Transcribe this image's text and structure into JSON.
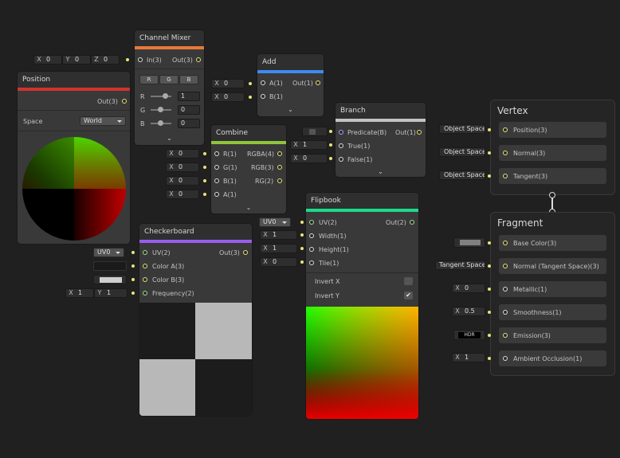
{
  "channel_mixer": {
    "title": "Channel Mixer",
    "in": "In(3)",
    "out": "Out(3)",
    "tabs": [
      "R",
      "G",
      "B"
    ],
    "rows": [
      {
        "label": "R",
        "value": "1"
      },
      {
        "label": "G",
        "value": "0"
      },
      {
        "label": "B",
        "value": "0"
      }
    ],
    "inputs": [
      {
        "k": "X",
        "v": "0"
      },
      {
        "k": "Y",
        "v": "0"
      },
      {
        "k": "Z",
        "v": "0"
      }
    ]
  },
  "position": {
    "title": "Position",
    "out": "Out(3)",
    "space_label": "Space",
    "space_value": "World"
  },
  "add": {
    "title": "Add",
    "a": "A(1)",
    "b": "B(1)",
    "out": "Out(1)",
    "inputs": [
      {
        "k": "X",
        "v": "0"
      },
      {
        "k": "X",
        "v": "0"
      }
    ]
  },
  "combine": {
    "title": "Combine",
    "ports_in": [
      "R(1)",
      "G(1)",
      "B(1)",
      "A(1)"
    ],
    "ports_out": [
      "RGBA(4)",
      "RGB(3)",
      "RG(2)"
    ],
    "inputs": [
      {
        "k": "X",
        "v": "0"
      },
      {
        "k": "X",
        "v": "0"
      },
      {
        "k": "X",
        "v": "0"
      },
      {
        "k": "X",
        "v": "0"
      }
    ]
  },
  "branch": {
    "title": "Branch",
    "ports_in": [
      "Predicate(B)",
      "True(1)",
      "False(1)"
    ],
    "out": "Out(1)",
    "inputs": [
      {
        "k": "X",
        "v": "1"
      },
      {
        "k": "X",
        "v": "0"
      }
    ]
  },
  "checkerboard": {
    "title": "Checkerboard",
    "ports_in": [
      "UV(2)",
      "Color A(3)",
      "Color B(3)",
      "Frequency(2)"
    ],
    "out": "Out(3)",
    "uv": "UV0",
    "freq": [
      {
        "k": "X",
        "v": "1"
      },
      {
        "k": "Y",
        "v": "1"
      }
    ]
  },
  "flipbook": {
    "title": "Flipbook",
    "ports_in": [
      "UV(2)",
      "Width(1)",
      "Height(1)",
      "Tile(1)"
    ],
    "out": "Out(2)",
    "uv": "UV0",
    "inputs": [
      {
        "k": "X",
        "v": "1"
      },
      {
        "k": "X",
        "v": "1"
      },
      {
        "k": "X",
        "v": "0"
      }
    ],
    "invert_x": "Invert X",
    "invert_y": "Invert Y",
    "check_mark": "✔"
  },
  "vertex": {
    "title": "Vertex",
    "items": [
      {
        "label": "Position(3)",
        "tag": "Object Space"
      },
      {
        "label": "Normal(3)",
        "tag": "Object Space"
      },
      {
        "label": "Tangent(3)",
        "tag": "Object Space"
      }
    ]
  },
  "fragment": {
    "title": "Fragment",
    "items": [
      {
        "label": "Base Color(3)"
      },
      {
        "label": "Normal (Tangent Space)(3)",
        "tag": "Tangent Space"
      },
      {
        "label": "Metallic(1)",
        "k": "X",
        "v": "0"
      },
      {
        "label": "Smoothness(1)",
        "k": "X",
        "v": "0.5"
      },
      {
        "label": "Emission(3)",
        "tag": "HDR"
      },
      {
        "label": "Ambient Occlusion(1)",
        "k": "X",
        "v": "1"
      }
    ]
  },
  "colors": {
    "channel_mixer": "#e8773a",
    "position": "#d0342c",
    "add": "#3d8bf0",
    "combine": "#8fc43c",
    "branch": "#c2c2c2",
    "checkerboard": "#9a5cf0",
    "flipbook": "#1ed98a"
  }
}
